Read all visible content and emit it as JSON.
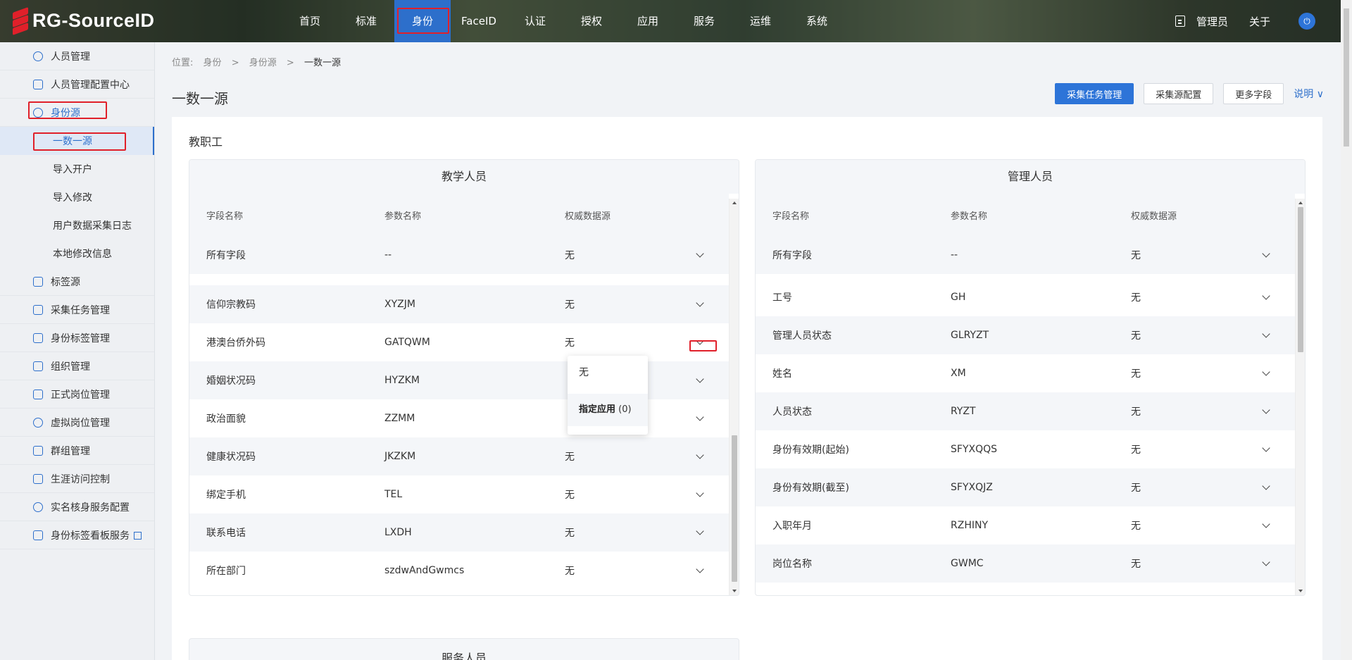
{
  "brand": {
    "name": "RG-SourceID"
  },
  "nav": {
    "items": [
      "首页",
      "标准",
      "身份",
      "FaceID",
      "认证",
      "授权",
      "应用",
      "服务",
      "运维",
      "系统"
    ],
    "active_index": 2
  },
  "topbar": {
    "user": "管理员",
    "about": "关于"
  },
  "sidebar": {
    "items": [
      {
        "label": "人员管理",
        "icon": "user-icon"
      },
      {
        "label": "人员管理配置中心",
        "icon": "config-icon"
      },
      {
        "label": "身份源",
        "icon": "identity-source-icon",
        "expanded": true,
        "children": [
          "一数一源",
          "导入开户",
          "导入修改",
          "用户数据采集日志",
          "本地修改信息"
        ],
        "active_child": 0
      },
      {
        "label": "标签源",
        "icon": "tag-icon"
      },
      {
        "label": "采集任务管理",
        "icon": "task-icon"
      },
      {
        "label": "身份标签管理",
        "icon": "bookmark-icon"
      },
      {
        "label": "组织管理",
        "icon": "org-icon"
      },
      {
        "label": "正式岗位管理",
        "icon": "card-icon"
      },
      {
        "label": "虚拟岗位管理",
        "icon": "user-gear-icon"
      },
      {
        "label": "群组管理",
        "icon": "group-icon"
      },
      {
        "label": "生涯访问控制",
        "icon": "access-icon"
      },
      {
        "label": "实名核身服务配置",
        "icon": "verify-icon"
      },
      {
        "label": "身份标签看板服务",
        "icon": "dashboard-icon"
      }
    ]
  },
  "breadcrumb": {
    "prefix": "位置:",
    "items": [
      "身份",
      "身份源",
      "一数一源"
    ],
    "separator": ">"
  },
  "page": {
    "title": "一数一源",
    "actions": {
      "primary": "采集任务管理",
      "source_config": "采集源配置",
      "more_fields": "更多字段",
      "help": "说明"
    },
    "section_title": "教职工"
  },
  "panels": {
    "teaching": {
      "title": "教学人员",
      "columns": [
        "字段名称",
        "参数名称",
        "权威数据源"
      ],
      "all_row": {
        "field": "所有字段",
        "param": "--",
        "source": "无"
      },
      "rows": [
        {
          "field": "信仰宗教码",
          "param": "XYZJM",
          "source": "无"
        },
        {
          "field": "港澳台侨外码",
          "param": "GATQWM",
          "source": "无"
        },
        {
          "field": "婚姻状况码",
          "param": "HYZKM",
          "source": ""
        },
        {
          "field": "政治面貌",
          "param": "ZZMM",
          "source": ""
        },
        {
          "field": "健康状况码",
          "param": "JKZKM",
          "source": "无"
        },
        {
          "field": "绑定手机",
          "param": "TEL",
          "source": "无"
        },
        {
          "field": "联系电话",
          "param": "LXDH",
          "source": "无"
        },
        {
          "field": "所在部门",
          "param": "szdwAndGwmcs",
          "source": "无"
        }
      ]
    },
    "management": {
      "title": "管理人员",
      "columns": [
        "字段名称",
        "参数名称",
        "权威数据源"
      ],
      "all_row": {
        "field": "所有字段",
        "param": "--",
        "source": "无"
      },
      "rows": [
        {
          "field": "工号",
          "param": "GH",
          "source": "无"
        },
        {
          "field": "管理人员状态",
          "param": "GLRYZT",
          "source": "无"
        },
        {
          "field": "姓名",
          "param": "XM",
          "source": "无"
        },
        {
          "field": "人员状态",
          "param": "RYZT",
          "source": "无"
        },
        {
          "field": "身份有效期(起始)",
          "param": "SFYXQQS",
          "source": "无"
        },
        {
          "field": "身份有效期(截至)",
          "param": "SFYXQJZ",
          "source": "无"
        },
        {
          "field": "入职年月",
          "param": "RZHINY",
          "source": "无"
        },
        {
          "field": "岗位名称",
          "param": "GWMC",
          "source": "无"
        }
      ]
    },
    "service": {
      "title": "服务人员"
    }
  },
  "dropdown": {
    "options": [
      {
        "label": "无"
      },
      {
        "label": "指定应用",
        "count": "(0)"
      }
    ]
  },
  "colors": {
    "brand_red": "#e0202a",
    "primary_blue": "#2d74d8",
    "highlight_red": "#e0202a"
  }
}
